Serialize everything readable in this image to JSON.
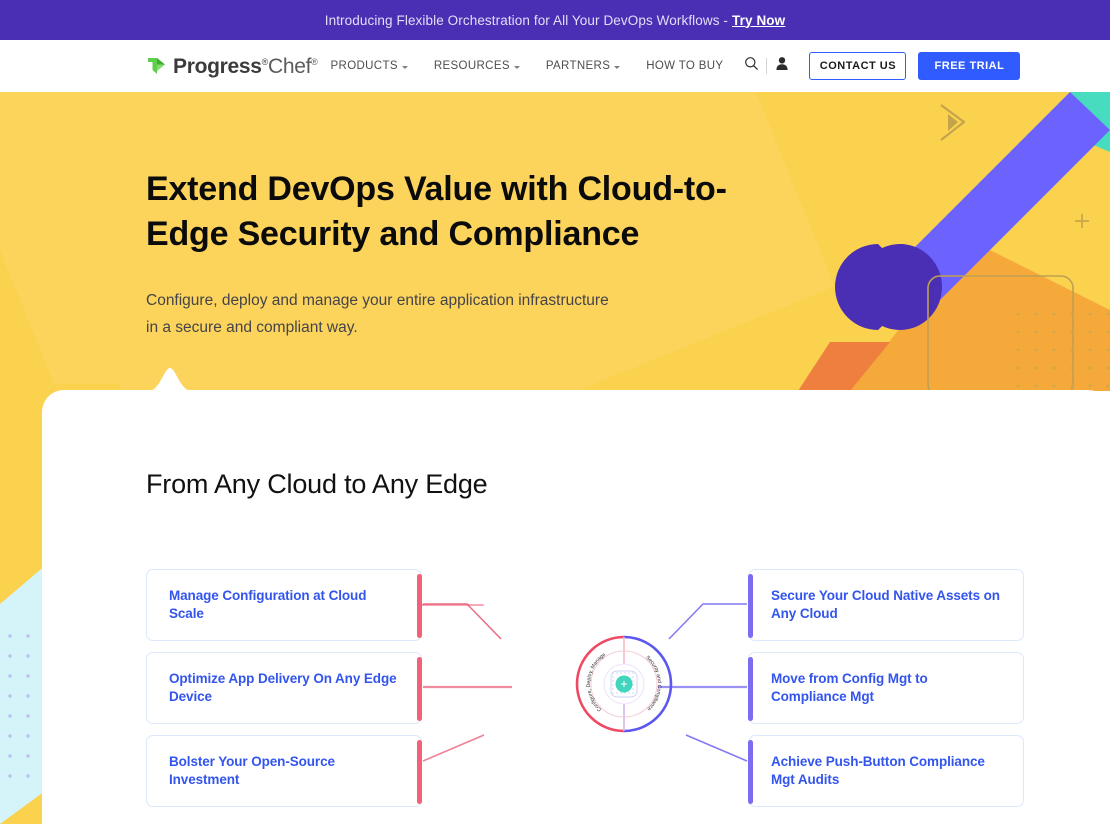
{
  "banner": {
    "text": "Introducing Flexible Orchestration for All Your DevOps Workflows -",
    "link_label": "Try Now",
    "background": "#4a2fb5"
  },
  "header": {
    "logo": {
      "brand": "Progress",
      "registered": "®",
      "product": "Chef",
      "product_registered": "®",
      "icon": "progress-chevron-logo-icon",
      "icon_color": "#5fcf4b"
    },
    "nav_items": [
      {
        "label": "PRODUCTS",
        "has_dropdown": true
      },
      {
        "label": "RESOURCES",
        "has_dropdown": true
      },
      {
        "label": "PARTNERS",
        "has_dropdown": true
      },
      {
        "label": "HOW TO BUY",
        "has_dropdown": false
      }
    ],
    "search_icon": "search-icon",
    "account_icon": "user-account-icon",
    "contact_button": "CONTACT US",
    "trial_button": "FREE TRIAL",
    "accent_color": "#2f5bff"
  },
  "hero": {
    "heading": "Extend DevOps Value with Cloud-to-Edge Security and Compliance",
    "subheading_line1": "Configure, deploy and manage your entire application infrastructure",
    "subheading_line2": "in a secure and compliant way.",
    "background": "#fbd24e",
    "decorations": [
      "chevron-outline-icon",
      "plus-mark-icon",
      "teal-triangle-shape",
      "purple-cylinder-shape",
      "orange-parallelogram-shape",
      "rounded-rect-outline-shape",
      "dot-grid-pattern"
    ]
  },
  "section": {
    "title": "From Any Cloud to Any Edge",
    "left_cards": [
      {
        "label": "Manage Configuration at Cloud Scale"
      },
      {
        "label": "Optimize App Delivery On Any Edge Device"
      },
      {
        "label": "Bolster Your Open-Source Investment"
      }
    ],
    "right_cards": [
      {
        "label": "Secure Your Cloud Native Assets on Any Cloud"
      },
      {
        "label": "Move from Config Mgt to Compliance Mgt"
      },
      {
        "label": "Achieve Push-Button Compliance Mgt Audits"
      }
    ],
    "left_accent_color": "#f2607a",
    "right_accent_color": "#7b6cf0",
    "card_text_color": "#3355ee",
    "ring": {
      "left_label": "Configure, Deploy, Manage",
      "right_label": "Security and Compliance",
      "left_arc_color": "#ef4a63",
      "right_arc_color": "#5b57ef",
      "core_color": "#3fd6bd",
      "core_icon": "gear-hub-icon"
    }
  }
}
